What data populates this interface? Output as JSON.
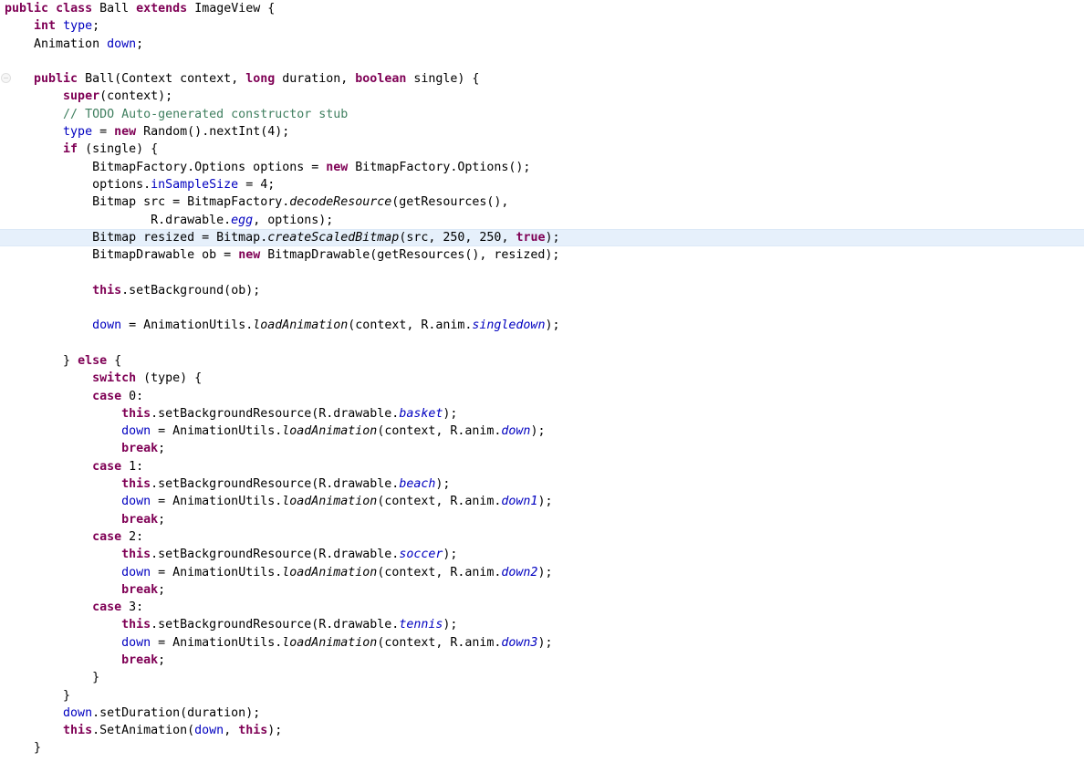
{
  "editor": {
    "language": "java",
    "class_name": "Ball",
    "file_kind": "java-source-editor",
    "colors": {
      "background": "#ffffff",
      "foreground": "#000000",
      "keyword": "#7f0055",
      "comment": "#3f7f5f",
      "field": "#0000c0",
      "static_field": "#0000c0",
      "string": "#2a00ff",
      "current_line_highlight": "#e6f0fb"
    },
    "gutter": {
      "fold_marker_name": "collapse-fold-marker",
      "fold_marker_line": 5
    },
    "highlighted_line_number": 13,
    "lines": [
      {
        "n": 1,
        "highlight": false,
        "tokens": [
          {
            "t": "kw",
            "s": "public"
          },
          {
            "t": "plain",
            "s": " "
          },
          {
            "t": "kw",
            "s": "class"
          },
          {
            "t": "plain",
            "s": " Ball "
          },
          {
            "t": "kw",
            "s": "extends"
          },
          {
            "t": "plain",
            "s": " ImageView {"
          }
        ]
      },
      {
        "n": 2,
        "highlight": false,
        "tokens": [
          {
            "t": "plain",
            "s": "    "
          },
          {
            "t": "kw",
            "s": "int"
          },
          {
            "t": "plain",
            "s": " "
          },
          {
            "t": "field",
            "s": "type"
          },
          {
            "t": "plain",
            "s": ";"
          }
        ]
      },
      {
        "n": 3,
        "highlight": false,
        "tokens": [
          {
            "t": "plain",
            "s": "    Animation "
          },
          {
            "t": "field",
            "s": "down"
          },
          {
            "t": "plain",
            "s": ";"
          }
        ]
      },
      {
        "n": 4,
        "highlight": false,
        "tokens": []
      },
      {
        "n": 5,
        "highlight": false,
        "tokens": [
          {
            "t": "plain",
            "s": "    "
          },
          {
            "t": "kw",
            "s": "public"
          },
          {
            "t": "plain",
            "s": " Ball(Context context, "
          },
          {
            "t": "kw",
            "s": "long"
          },
          {
            "t": "plain",
            "s": " duration, "
          },
          {
            "t": "kw",
            "s": "boolean"
          },
          {
            "t": "plain",
            "s": " single) {"
          }
        ]
      },
      {
        "n": 6,
        "highlight": false,
        "tokens": [
          {
            "t": "plain",
            "s": "        "
          },
          {
            "t": "kw",
            "s": "super"
          },
          {
            "t": "plain",
            "s": "(context);"
          }
        ]
      },
      {
        "n": 7,
        "highlight": false,
        "tokens": [
          {
            "t": "plain",
            "s": "        "
          },
          {
            "t": "cmt",
            "s": "// TODO Auto-generated constructor stub"
          }
        ]
      },
      {
        "n": 8,
        "highlight": false,
        "tokens": [
          {
            "t": "plain",
            "s": "        "
          },
          {
            "t": "field",
            "s": "type"
          },
          {
            "t": "plain",
            "s": " = "
          },
          {
            "t": "kw",
            "s": "new"
          },
          {
            "t": "plain",
            "s": " Random().nextInt("
          },
          {
            "t": "num",
            "s": "4"
          },
          {
            "t": "plain",
            "s": ");"
          }
        ]
      },
      {
        "n": 9,
        "highlight": false,
        "tokens": [
          {
            "t": "plain",
            "s": "        "
          },
          {
            "t": "kw",
            "s": "if"
          },
          {
            "t": "plain",
            "s": " (single) {"
          }
        ]
      },
      {
        "n": 10,
        "highlight": false,
        "tokens": [
          {
            "t": "plain",
            "s": "            BitmapFactory.Options options = "
          },
          {
            "t": "kw",
            "s": "new"
          },
          {
            "t": "plain",
            "s": " BitmapFactory.Options();"
          }
        ]
      },
      {
        "n": 11,
        "highlight": false,
        "tokens": [
          {
            "t": "plain",
            "s": "            options."
          },
          {
            "t": "field",
            "s": "inSampleSize"
          },
          {
            "t": "plain",
            "s": " = "
          },
          {
            "t": "num",
            "s": "4"
          },
          {
            "t": "plain",
            "s": ";"
          }
        ]
      },
      {
        "n": 12,
        "highlight": false,
        "tokens": [
          {
            "t": "plain",
            "s": "            Bitmap src = BitmapFactory."
          },
          {
            "t": "smethod",
            "s": "decodeResource"
          },
          {
            "t": "plain",
            "s": "(getResources(),"
          }
        ]
      },
      {
        "n": 13,
        "highlight": false,
        "tokens": [
          {
            "t": "plain",
            "s": "                    R.drawable."
          },
          {
            "t": "sfield",
            "s": "egg"
          },
          {
            "t": "plain",
            "s": ", options);"
          }
        ]
      },
      {
        "n": 14,
        "highlight": true,
        "tokens": [
          {
            "t": "plain",
            "s": "            Bitmap resized = Bitmap."
          },
          {
            "t": "smethod",
            "s": "createScaledBitmap"
          },
          {
            "t": "plain",
            "s": "(src, "
          },
          {
            "t": "num",
            "s": "250"
          },
          {
            "t": "plain",
            "s": ", "
          },
          {
            "t": "num",
            "s": "250"
          },
          {
            "t": "plain",
            "s": ", "
          },
          {
            "t": "kw",
            "s": "true"
          },
          {
            "t": "plain",
            "s": ");"
          }
        ]
      },
      {
        "n": 15,
        "highlight": false,
        "tokens": [
          {
            "t": "plain",
            "s": "            BitmapDrawable ob = "
          },
          {
            "t": "kw",
            "s": "new"
          },
          {
            "t": "plain",
            "s": " BitmapDrawable(getResources(), resized);"
          }
        ]
      },
      {
        "n": 16,
        "highlight": false,
        "tokens": []
      },
      {
        "n": 17,
        "highlight": false,
        "tokens": [
          {
            "t": "plain",
            "s": "            "
          },
          {
            "t": "kw",
            "s": "this"
          },
          {
            "t": "plain",
            "s": ".setBackground(ob);"
          }
        ]
      },
      {
        "n": 18,
        "highlight": false,
        "tokens": []
      },
      {
        "n": 19,
        "highlight": false,
        "tokens": [
          {
            "t": "plain",
            "s": "            "
          },
          {
            "t": "field",
            "s": "down"
          },
          {
            "t": "plain",
            "s": " = AnimationUtils."
          },
          {
            "t": "smethod",
            "s": "loadAnimation"
          },
          {
            "t": "plain",
            "s": "(context, R.anim."
          },
          {
            "t": "sfield",
            "s": "singledown"
          },
          {
            "t": "plain",
            "s": ");"
          }
        ]
      },
      {
        "n": 20,
        "highlight": false,
        "tokens": []
      },
      {
        "n": 21,
        "highlight": false,
        "tokens": [
          {
            "t": "plain",
            "s": "        } "
          },
          {
            "t": "kw",
            "s": "else"
          },
          {
            "t": "plain",
            "s": " {"
          }
        ]
      },
      {
        "n": 22,
        "highlight": false,
        "tokens": [
          {
            "t": "plain",
            "s": "            "
          },
          {
            "t": "kw",
            "s": "switch"
          },
          {
            "t": "plain",
            "s": " (type) {"
          }
        ]
      },
      {
        "n": 23,
        "highlight": false,
        "tokens": [
          {
            "t": "plain",
            "s": "            "
          },
          {
            "t": "kw",
            "s": "case"
          },
          {
            "t": "plain",
            "s": " "
          },
          {
            "t": "num",
            "s": "0"
          },
          {
            "t": "plain",
            "s": ":"
          }
        ]
      },
      {
        "n": 24,
        "highlight": false,
        "tokens": [
          {
            "t": "plain",
            "s": "                "
          },
          {
            "t": "kw",
            "s": "this"
          },
          {
            "t": "plain",
            "s": ".setBackgroundResource(R.drawable."
          },
          {
            "t": "sfield",
            "s": "basket"
          },
          {
            "t": "plain",
            "s": ");"
          }
        ]
      },
      {
        "n": 25,
        "highlight": false,
        "tokens": [
          {
            "t": "plain",
            "s": "                "
          },
          {
            "t": "field",
            "s": "down"
          },
          {
            "t": "plain",
            "s": " = AnimationUtils."
          },
          {
            "t": "smethod",
            "s": "loadAnimation"
          },
          {
            "t": "plain",
            "s": "(context, R.anim."
          },
          {
            "t": "sfield",
            "s": "down"
          },
          {
            "t": "plain",
            "s": ");"
          }
        ]
      },
      {
        "n": 26,
        "highlight": false,
        "tokens": [
          {
            "t": "plain",
            "s": "                "
          },
          {
            "t": "kw",
            "s": "break"
          },
          {
            "t": "plain",
            "s": ";"
          }
        ]
      },
      {
        "n": 27,
        "highlight": false,
        "tokens": [
          {
            "t": "plain",
            "s": "            "
          },
          {
            "t": "kw",
            "s": "case"
          },
          {
            "t": "plain",
            "s": " "
          },
          {
            "t": "num",
            "s": "1"
          },
          {
            "t": "plain",
            "s": ":"
          }
        ]
      },
      {
        "n": 28,
        "highlight": false,
        "tokens": [
          {
            "t": "plain",
            "s": "                "
          },
          {
            "t": "kw",
            "s": "this"
          },
          {
            "t": "plain",
            "s": ".setBackgroundResource(R.drawable."
          },
          {
            "t": "sfield",
            "s": "beach"
          },
          {
            "t": "plain",
            "s": ");"
          }
        ]
      },
      {
        "n": 29,
        "highlight": false,
        "tokens": [
          {
            "t": "plain",
            "s": "                "
          },
          {
            "t": "field",
            "s": "down"
          },
          {
            "t": "plain",
            "s": " = AnimationUtils."
          },
          {
            "t": "smethod",
            "s": "loadAnimation"
          },
          {
            "t": "plain",
            "s": "(context, R.anim."
          },
          {
            "t": "sfield",
            "s": "down1"
          },
          {
            "t": "plain",
            "s": ");"
          }
        ]
      },
      {
        "n": 30,
        "highlight": false,
        "tokens": [
          {
            "t": "plain",
            "s": "                "
          },
          {
            "t": "kw",
            "s": "break"
          },
          {
            "t": "plain",
            "s": ";"
          }
        ]
      },
      {
        "n": 31,
        "highlight": false,
        "tokens": [
          {
            "t": "plain",
            "s": "            "
          },
          {
            "t": "kw",
            "s": "case"
          },
          {
            "t": "plain",
            "s": " "
          },
          {
            "t": "num",
            "s": "2"
          },
          {
            "t": "plain",
            "s": ":"
          }
        ]
      },
      {
        "n": 32,
        "highlight": false,
        "tokens": [
          {
            "t": "plain",
            "s": "                "
          },
          {
            "t": "kw",
            "s": "this"
          },
          {
            "t": "plain",
            "s": ".setBackgroundResource(R.drawable."
          },
          {
            "t": "sfield",
            "s": "soccer"
          },
          {
            "t": "plain",
            "s": ");"
          }
        ]
      },
      {
        "n": 33,
        "highlight": false,
        "tokens": [
          {
            "t": "plain",
            "s": "                "
          },
          {
            "t": "field",
            "s": "down"
          },
          {
            "t": "plain",
            "s": " = AnimationUtils."
          },
          {
            "t": "smethod",
            "s": "loadAnimation"
          },
          {
            "t": "plain",
            "s": "(context, R.anim."
          },
          {
            "t": "sfield",
            "s": "down2"
          },
          {
            "t": "plain",
            "s": ");"
          }
        ]
      },
      {
        "n": 34,
        "highlight": false,
        "tokens": [
          {
            "t": "plain",
            "s": "                "
          },
          {
            "t": "kw",
            "s": "break"
          },
          {
            "t": "plain",
            "s": ";"
          }
        ]
      },
      {
        "n": 35,
        "highlight": false,
        "tokens": [
          {
            "t": "plain",
            "s": "            "
          },
          {
            "t": "kw",
            "s": "case"
          },
          {
            "t": "plain",
            "s": " "
          },
          {
            "t": "num",
            "s": "3"
          },
          {
            "t": "plain",
            "s": ":"
          }
        ]
      },
      {
        "n": 36,
        "highlight": false,
        "tokens": [
          {
            "t": "plain",
            "s": "                "
          },
          {
            "t": "kw",
            "s": "this"
          },
          {
            "t": "plain",
            "s": ".setBackgroundResource(R.drawable."
          },
          {
            "t": "sfield",
            "s": "tennis"
          },
          {
            "t": "plain",
            "s": ");"
          }
        ]
      },
      {
        "n": 37,
        "highlight": false,
        "tokens": [
          {
            "t": "plain",
            "s": "                "
          },
          {
            "t": "field",
            "s": "down"
          },
          {
            "t": "plain",
            "s": " = AnimationUtils."
          },
          {
            "t": "smethod",
            "s": "loadAnimation"
          },
          {
            "t": "plain",
            "s": "(context, R.anim."
          },
          {
            "t": "sfield",
            "s": "down3"
          },
          {
            "t": "plain",
            "s": ");"
          }
        ]
      },
      {
        "n": 38,
        "highlight": false,
        "tokens": [
          {
            "t": "plain",
            "s": "                "
          },
          {
            "t": "kw",
            "s": "break"
          },
          {
            "t": "plain",
            "s": ";"
          }
        ]
      },
      {
        "n": 39,
        "highlight": false,
        "tokens": [
          {
            "t": "plain",
            "s": "            }"
          }
        ]
      },
      {
        "n": 40,
        "highlight": false,
        "tokens": [
          {
            "t": "plain",
            "s": "        }"
          }
        ]
      },
      {
        "n": 41,
        "highlight": false,
        "tokens": [
          {
            "t": "plain",
            "s": "        "
          },
          {
            "t": "field",
            "s": "down"
          },
          {
            "t": "plain",
            "s": ".setDuration(duration);"
          }
        ]
      },
      {
        "n": 42,
        "highlight": false,
        "tokens": [
          {
            "t": "plain",
            "s": "        "
          },
          {
            "t": "kw",
            "s": "this"
          },
          {
            "t": "plain",
            "s": ".SetAnimation("
          },
          {
            "t": "field",
            "s": "down"
          },
          {
            "t": "plain",
            "s": ", "
          },
          {
            "t": "kw",
            "s": "this"
          },
          {
            "t": "plain",
            "s": ");"
          }
        ]
      },
      {
        "n": 43,
        "highlight": false,
        "tokens": [
          {
            "t": "plain",
            "s": "    }"
          }
        ]
      }
    ]
  }
}
